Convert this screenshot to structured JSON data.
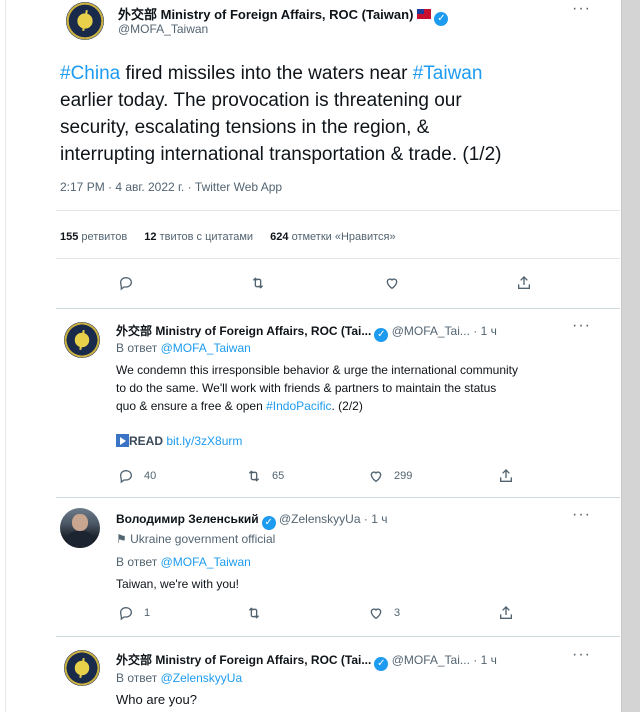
{
  "main_tweet": {
    "author_name": "外交部 Ministry of Foreign Affairs, ROC (Taiwan)",
    "handle": "@MOFA_Taiwan",
    "text_parts": [
      {
        "text": "#China",
        "link": true
      },
      {
        "text": " fired missiles into the waters near ",
        "link": false
      },
      {
        "text": "#Taiwan",
        "link": true
      }
    ],
    "text_line2": "earlier today. The provocation is threatening our",
    "text_line3": "security, escalating tensions in the region, &",
    "text_line4": "interrupting international transportation & trade. (1/2)",
    "meta": "2:17 PM · 4 авг. 2022 г. · Twitter Web App",
    "stats": {
      "retweets_count": "155",
      "retweets_label": "ретвитов",
      "quotes_count": "12",
      "quotes_label": "твитов с цитатами",
      "likes_count": "624",
      "likes_label": "отметки «Нравится»"
    },
    "more": "···"
  },
  "replies": [
    {
      "author_name": "外交部 Ministry of Foreign Affairs, ROC (Tai...",
      "handle_time": "@MOFA_Tai... · 1 ч",
      "reply_prefix": "В ответ",
      "reply_to": "@MOFA_Taiwan",
      "line1": "We condemn this irresponsible behavior & urge the international community",
      "line2": "to do the same. We'll work with friends & partners to maintain the status",
      "line3_a": "quo & ensure a free & open ",
      "line3_link": "#IndoPacific",
      "line3_b": ". (2/2)",
      "read_label": "READ",
      "read_link": "bit.ly/3zX8urm",
      "replies_count": "40",
      "retweets_count": "65",
      "likes_count": "299",
      "more": "···"
    },
    {
      "author_name": "Володимир Зеленський",
      "handle_time": "@ZelenskyyUa · 1 ч",
      "label": "Ukraine government official",
      "reply_prefix": "В ответ",
      "reply_to": "@MOFA_Taiwan",
      "line1": "Taiwan, we're with you!",
      "replies_count": "1",
      "retweets_count": "",
      "likes_count": "3",
      "more": "···"
    },
    {
      "author_name": "外交部 Ministry of Foreign Affairs, ROC (Tai...",
      "handle_time": "@MOFA_Tai... · 1 ч",
      "reply_prefix": "В ответ",
      "reply_to": "@ZelenskyyUa",
      "line1": "Who are you?",
      "more": "···"
    }
  ]
}
